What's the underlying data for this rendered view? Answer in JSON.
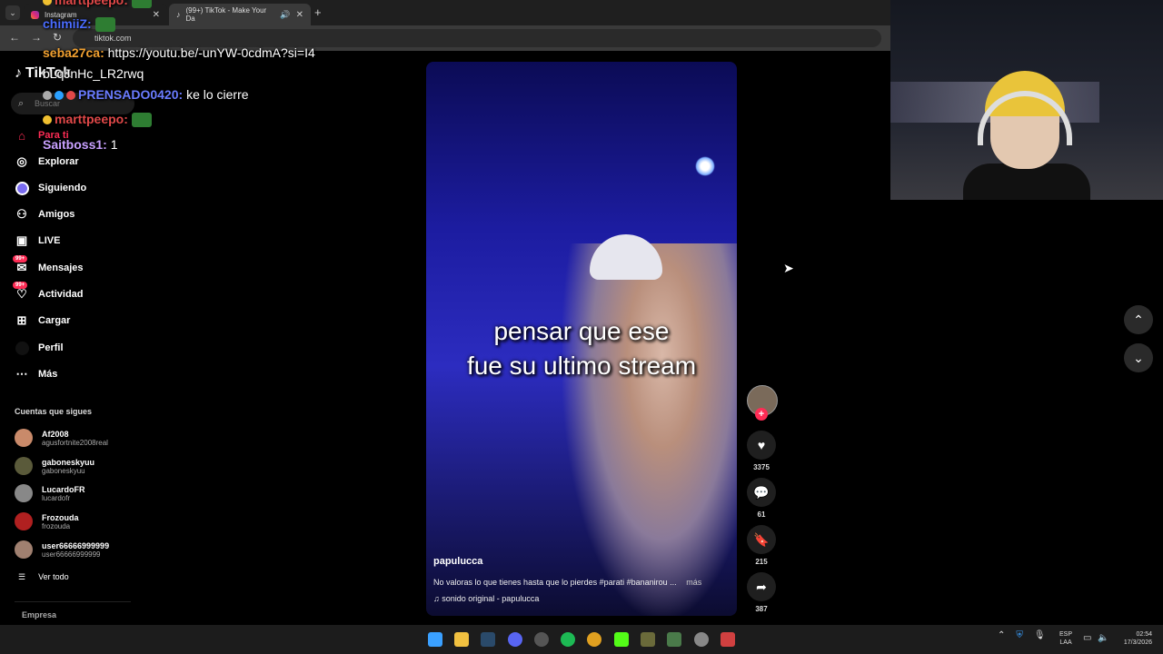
{
  "browser": {
    "tabs": [
      {
        "label": "Instagram"
      },
      {
        "label": "(99+) TikTok - Make Your Da",
        "active": true
      }
    ],
    "url": "tiktok.com"
  },
  "sidebar": {
    "logo": "TikTok",
    "search_placeholder": "Buscar",
    "nav": [
      {
        "label": "Para ti",
        "icon": "home-icon",
        "active": true
      },
      {
        "label": "Explorar",
        "icon": "compass-icon"
      },
      {
        "label": "Siguiendo",
        "icon": "following-icon"
      },
      {
        "label": "Amigos",
        "icon": "friends-icon"
      },
      {
        "label": "LIVE",
        "icon": "live-icon"
      },
      {
        "label": "Mensajes",
        "icon": "messages-icon",
        "badge": "99+"
      },
      {
        "label": "Actividad",
        "icon": "activity-icon",
        "badge": "99+"
      },
      {
        "label": "Cargar",
        "icon": "upload-icon"
      },
      {
        "label": "Perfil",
        "icon": "profile-icon"
      },
      {
        "label": "Más",
        "icon": "more-icon"
      }
    ],
    "following_heading": "Cuentas que sigues",
    "accounts": [
      {
        "name": "Af2008",
        "handle": "agusfortnite2008real"
      },
      {
        "name": "gaboneskyuu",
        "handle": "gaboneskyuu"
      },
      {
        "name": "LucardoFR",
        "handle": "lucardofr"
      },
      {
        "name": "Frozouda",
        "handle": "frozouda"
      },
      {
        "name": "user66666999999",
        "handle": "user66666999999"
      }
    ],
    "see_all": "Ver todo",
    "footer": "Empresa"
  },
  "chat": [
    {
      "user": "marttpeepo",
      "msg": "",
      "color": "#e04848"
    },
    {
      "user": "chimiiZ",
      "msg": "",
      "color": "#4a6cff"
    },
    {
      "user": "seba27ca",
      "msg": "https://youtu.be/-unYW-0cdmA?si=I4bLqJnHc_LR2rwq",
      "color": "#f0a030"
    },
    {
      "user": "PRENSADO0420",
      "msg": "ke lo cierre",
      "color": "#6a7cff"
    },
    {
      "user": "marttpeepo",
      "msg": "",
      "color": "#e04848"
    },
    {
      "user": "Saitboss1",
      "msg": "1",
      "color": "#c8a0ff"
    }
  ],
  "video": {
    "caption_line1": "pensar que ese",
    "caption_line2": "fue su ultimo stream",
    "author": "papulucca",
    "description": "No valoras lo que tienes hasta que lo pierdes #parati #bananirou ...",
    "more": "más",
    "sound": "sonido original - papulucca"
  },
  "actions": {
    "likes": "3375",
    "comments": "61",
    "saves": "215",
    "shares": "387"
  },
  "taskbar": {
    "lang_line1": "ESP",
    "lang_line2": "LAA",
    "time": "02:54",
    "date": "17/3/2026"
  }
}
